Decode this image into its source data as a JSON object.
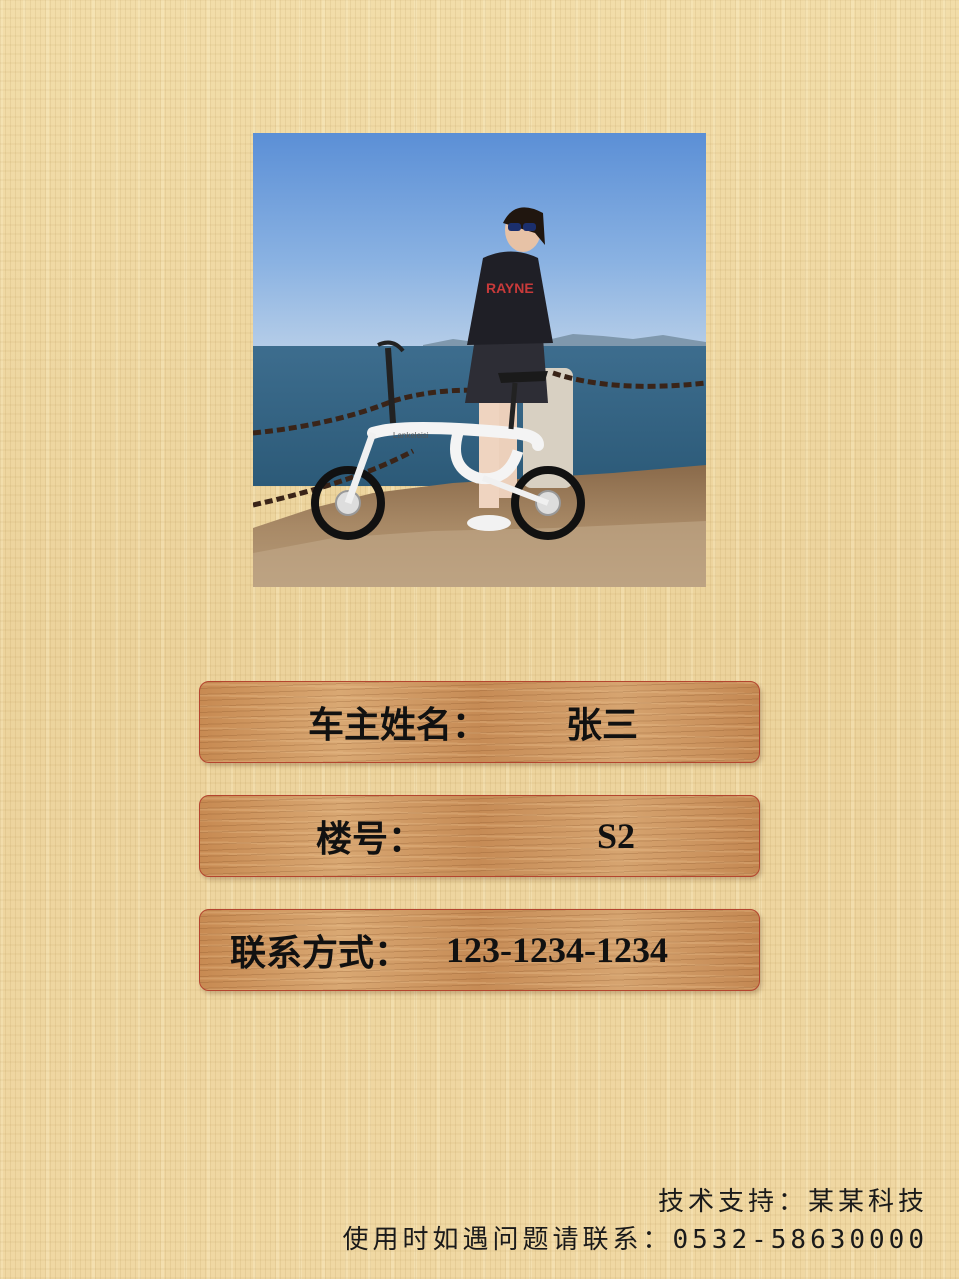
{
  "photo": {
    "alt": "bike-owner-photo",
    "bike_brand_text": "Lankeleisi",
    "shirt_text": "RAYNE"
  },
  "owner": {
    "label": "车主姓名：",
    "value": "张三"
  },
  "building": {
    "label": "楼号：",
    "value": "S2"
  },
  "contact": {
    "label": "联系方式：",
    "value": "123-1234-1234"
  },
  "footer": {
    "support": "技术支持：某某科技",
    "help": "使用时如遇问题请联系：0532-58630000"
  },
  "colors": {
    "background": "#efd7a0",
    "plate_wood": "#c98f57",
    "plate_border": "#b4452f",
    "text": "#111111"
  }
}
